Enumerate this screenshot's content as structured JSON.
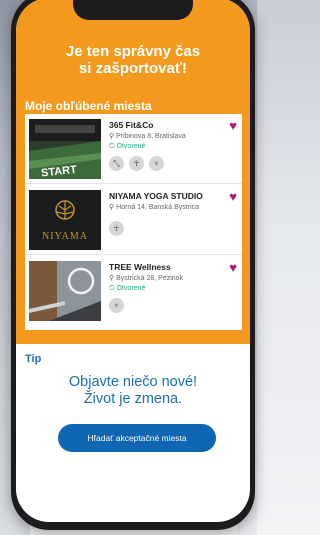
{
  "hero": {
    "line1": "Je ten správny čas",
    "line2": "si zašportovať!"
  },
  "favorites": {
    "title": "Moje obľúbené miesta",
    "items": [
      {
        "name": "365 Fit&Co",
        "address": "Pribinova 8, Bratislava",
        "status": "Otvorené",
        "icons": [
          "fitness-icon",
          "person-icon",
          "yoga-icon"
        ]
      },
      {
        "name": "NIYAMA YOGA STUDIO",
        "address": "Horná 14, Banská Bystrica",
        "logo_text": "NIYAMA",
        "icons": [
          "person-icon"
        ]
      },
      {
        "name": "TREE Wellness",
        "address": "Bystrická 28, Pezinok",
        "status": "Otvorené",
        "icons": [
          "yoga-icon"
        ]
      }
    ]
  },
  "tip": {
    "label": "Tip",
    "line1": "Objavte niečo nové!",
    "line2": "Život je zmena."
  },
  "cta": {
    "label": "Hľadať akceptačné miesta"
  },
  "colors": {
    "orange": "#f39a1e",
    "blue": "#1a6fb8",
    "button_blue": "#0f66b3",
    "heart": "#b3167a",
    "status_green": "#1faa8a"
  }
}
